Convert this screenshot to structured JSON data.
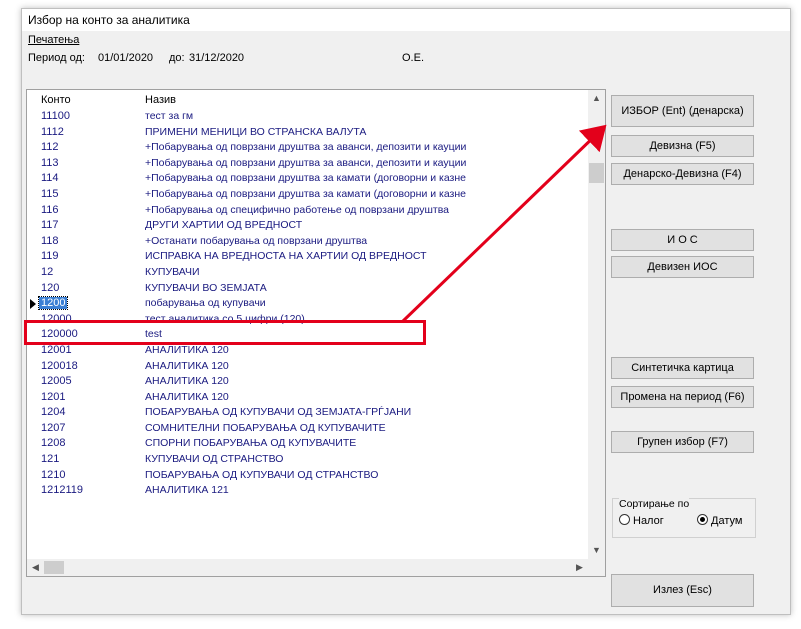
{
  "window": {
    "title": "Избор на конто за аналитика"
  },
  "menu": {
    "print_label": "Печатења"
  },
  "period": {
    "from_label": "Период од:",
    "from_value": "01/01/2020",
    "to_label": "до:",
    "to_value": "31/12/2020",
    "unit": "О.Е."
  },
  "grid": {
    "columns": [
      "Конто",
      "Назив"
    ],
    "rows": [
      {
        "code": "11100",
        "name": "тест за гм"
      },
      {
        "code": "1112",
        "name": "ПРИМЕНИ МЕНИЦИ ВО СТРАНСКА ВАЛУТА"
      },
      {
        "code": "112",
        "name": "+Побарувања од поврзани друштва за аванси, депозити и кауции"
      },
      {
        "code": "113",
        "name": "+Побарувања од поврзани друштва за аванси, депозити и кауции"
      },
      {
        "code": "114",
        "name": "+Побарувања од поврзани друштва за камати (договорни и казне"
      },
      {
        "code": "115",
        "name": "+Побарувања од поврзани друштва за камати (договорни и казне"
      },
      {
        "code": "116",
        "name": "+Побарувања од специфично работење од поврзани друштва"
      },
      {
        "code": "117",
        "name": "ДРУГИ ХАРТИИ ОД ВРЕДНОСТ"
      },
      {
        "code": "118",
        "name": "+Останати побарувања од поврзани друштва"
      },
      {
        "code": "119",
        "name": "ИСПРАВКА НА ВРЕДНОСТА НА ХАРТИИ ОД ВРЕДНОСТ"
      },
      {
        "code": "12",
        "name": "КУПУВАЧИ"
      },
      {
        "code": "120",
        "name": "КУПУВАЧИ ВО ЗЕМЈАТА"
      },
      {
        "code": "1200",
        "name": "побарувања од купувачи"
      },
      {
        "code": "12000",
        "name": "тест аналитика со 5 цифри (120)"
      },
      {
        "code": "120000",
        "name": "test"
      },
      {
        "code": "12001",
        "name": "АНАЛИТИКА 120"
      },
      {
        "code": "120018",
        "name": "АНАЛИТИКА 120"
      },
      {
        "code": "12005",
        "name": "АНАЛИТИКА 120"
      },
      {
        "code": "1201",
        "name": "АНАЛИТИКА 120"
      },
      {
        "code": "1204",
        "name": "ПОБАРУВАЊА ОД КУПУВАЧИ ОД ЗЕМЈАТА-ГРЃЈАНИ"
      },
      {
        "code": "1207",
        "name": "СОМНИТЕЛНИ ПОБАРУВАЊА ОД КУПУВАЧИТЕ"
      },
      {
        "code": "1208",
        "name": "СПОРНИ ПОБАРУВАЊА ОД КУПУВАЧИТЕ"
      },
      {
        "code": "121",
        "name": "КУПУВАЧИ ОД СТРАНСТВО"
      },
      {
        "code": "1210",
        "name": "ПОБАРУВАЊА ОД КУПУВАЧИ ОД СТРАНСТВО"
      },
      {
        "code": "1212119",
        "name": "АНАЛИТИКА 121"
      }
    ]
  },
  "buttons": {
    "izbor": "ИЗБОР (Ent) (денарска)",
    "devizna": "Девизна (F5)",
    "denarsko_devizna": "Денарско-Девизна (F4)",
    "ios": "И О С",
    "devizen_ios": "Девизен ИОС",
    "sintetichka": "Синтетичка картица",
    "promena": "Промена на период (F6)",
    "grupen": "Групен избор (F7)",
    "izlez": "Излез (Esc)"
  },
  "sort": {
    "label": "Сортирање по",
    "option1": "Налог",
    "option2": "Датум",
    "selected": "Датум"
  },
  "colors": {
    "highlight": "#e3001b",
    "selection": "#3b7fd4",
    "text": "#1a1a80"
  }
}
